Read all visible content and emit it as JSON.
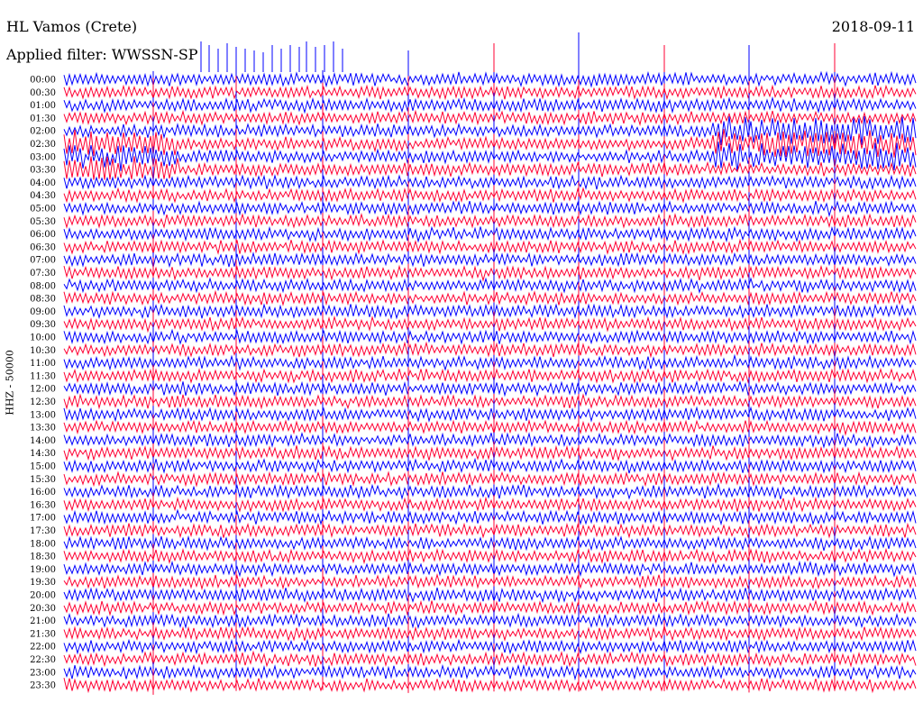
{
  "header": {
    "title": "HL Vamos (Crete)",
    "filter": "Applied filter: WWSSN-SP",
    "date": "2018-09-11"
  },
  "chart_data": {
    "type": "line",
    "title": "HL Vamos (Crete)",
    "subtitle": "Applied filter: WWSSN-SP",
    "date": "2018-09-11",
    "ylabel": "HHZ - 50000",
    "xlabel": "",
    "grid": false,
    "series_colors": [
      "#0000ff",
      "#ff0033"
    ],
    "rows": [
      "00:00",
      "00:30",
      "01:00",
      "01:30",
      "02:00",
      "02:30",
      "03:00",
      "03:30",
      "04:00",
      "04:30",
      "05:00",
      "05:30",
      "06:00",
      "06:30",
      "07:00",
      "07:30",
      "08:00",
      "08:30",
      "09:00",
      "09:30",
      "10:00",
      "10:30",
      "11:00",
      "11:30",
      "12:00",
      "12:30",
      "13:00",
      "13:30",
      "14:00",
      "14:30",
      "15:00",
      "15:30",
      "16:00",
      "16:30",
      "17:00",
      "17:30",
      "18:00",
      "18:30",
      "19:00",
      "19:30",
      "20:00",
      "20:30",
      "21:00",
      "21:30",
      "22:00",
      "22:30",
      "23:00",
      "23:30"
    ]
  }
}
